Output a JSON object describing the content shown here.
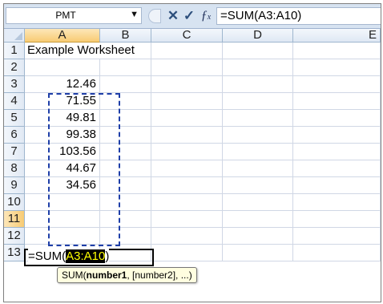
{
  "formula_bar": {
    "name_box": "PMT",
    "dropdown_icon": "chevron-down-icon",
    "cancel_icon": "close-icon",
    "enter_icon": "check-icon",
    "function_icon": "fx-icon",
    "formula": "=SUM(A3:A10)"
  },
  "columns": [
    "A",
    "B",
    "C",
    "D",
    "E"
  ],
  "rows": [
    {
      "num": "1",
      "a": "Example Worksheet"
    },
    {
      "num": "2",
      "a": ""
    },
    {
      "num": "3",
      "a": "12.46"
    },
    {
      "num": "4",
      "a": "71.55"
    },
    {
      "num": "5",
      "a": "49.81"
    },
    {
      "num": "6",
      "a": "99.38"
    },
    {
      "num": "7",
      "a": "103.56"
    },
    {
      "num": "8",
      "a": "44.67"
    },
    {
      "num": "9",
      "a": "34.56"
    },
    {
      "num": "10",
      "a": ""
    },
    {
      "num": "11",
      "a": ""
    },
    {
      "num": "12",
      "a": ""
    },
    {
      "num": "13",
      "a": ""
    }
  ],
  "editing": {
    "prefix": "=SUM(",
    "range": "A3:A10",
    "suffix": ")"
  },
  "tooltip": {
    "func": "SUM(",
    "arg_bold": "number1",
    "rest": ", [number2], ...)"
  },
  "colors": {
    "highlight_bg": "#000000",
    "highlight_text": "#ffff00",
    "marquee": "#1f3fa8"
  }
}
